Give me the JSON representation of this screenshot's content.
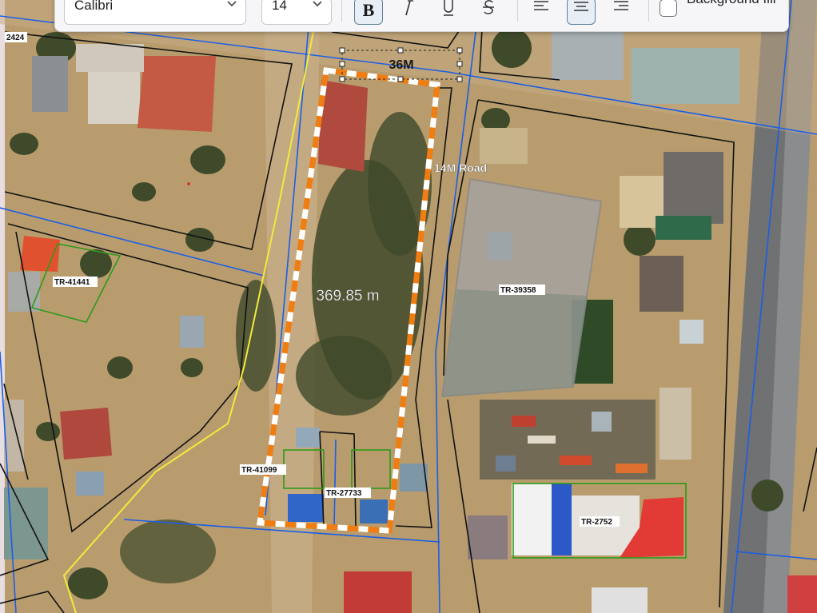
{
  "toolbar": {
    "font_family": "Calibri",
    "font_size": "14",
    "bold_label": "B",
    "background_fill_label": "Background fill",
    "background_fill_checked": false,
    "bold_active": true,
    "align_center_active": true
  },
  "map": {
    "measure_length_label": "369.85 m",
    "road_width_label": "36M",
    "road_name_label": "14M Road",
    "parcels": [
      "2424",
      "TR-41441",
      "TR-39358",
      "TR-41099",
      "TR-27733",
      "TR-2752"
    ],
    "colors": {
      "selection_outline": "#f07d12",
      "parcel_boundary": "#111111",
      "grid_line": "#1c5ee6",
      "highlight_parcel": "#2e9a1a",
      "road_centerline": "#e8e23a",
      "overlay_fill": "#9a9a9a"
    }
  }
}
